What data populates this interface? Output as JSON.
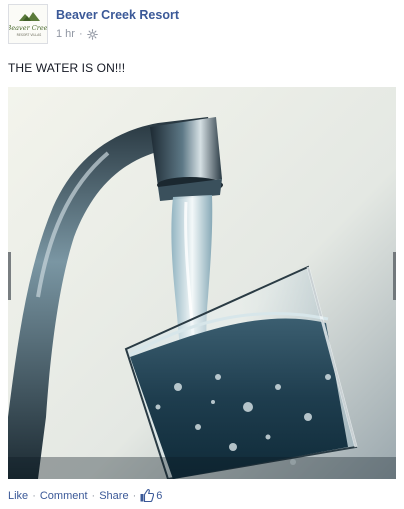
{
  "post": {
    "page_name": "Beaver Creek Resort",
    "timestamp": "1 hr",
    "privacy_icon": "public-icon",
    "text": "THE WATER IS ON!!!",
    "avatar_logo_text": "Beaver Creek",
    "avatar_logo_subtext": "RESORT VILLAS",
    "photo_description_icon": "water-faucet-photo"
  },
  "actions": {
    "like": "Like",
    "comment": "Comment",
    "share": "Share",
    "separator": "·",
    "like_count": "6"
  },
  "colors": {
    "link": "#3b5998",
    "meta": "#9197a3",
    "text": "#141823"
  }
}
